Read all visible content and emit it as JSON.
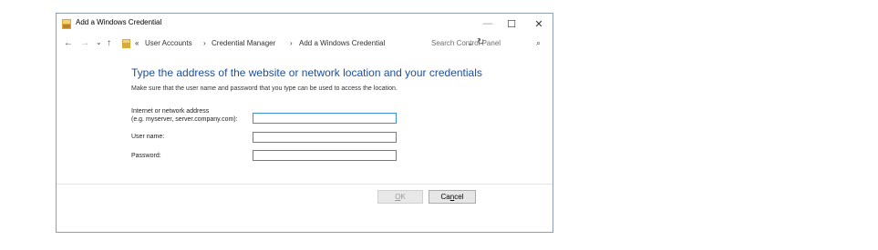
{
  "window": {
    "title": "Add a Windows Credential",
    "controls": {
      "minimize": "—",
      "maximize": "☐",
      "close": "✕"
    }
  },
  "nav": {
    "back": "←",
    "forward": "→",
    "recent": "⌄",
    "up": "↑",
    "breadcrumb": {
      "overflow": "«",
      "items": [
        "User Accounts",
        "Credential Manager",
        "Add a Windows Credential"
      ],
      "separator": "›"
    },
    "dropdown": "⌄",
    "refresh": "↻",
    "search_placeholder": "Search Control Panel",
    "search_icon": "⌕"
  },
  "content": {
    "heading": "Type the address of the website or network location and your credentials",
    "description": "Make sure that the user name and password that you type can be used to access the location.",
    "fields": [
      {
        "label_line1": "Internet or network address",
        "label_line2": "(e.g. myserver, server.company.com):",
        "value": ""
      },
      {
        "label_line1": "User name:",
        "value": ""
      },
      {
        "label_line1": "Password:",
        "value": ""
      }
    ]
  },
  "buttons": {
    "ok_prefix": "",
    "ok_mnemonic": "O",
    "ok_rest": "K",
    "cancel_prefix": "Ca",
    "cancel_mnemonic": "n",
    "cancel_rest": "cel"
  },
  "colors": {
    "heading": "#1e4e9c",
    "focus_border": "#3c8fd7",
    "window_border": "#8a9fb5"
  }
}
